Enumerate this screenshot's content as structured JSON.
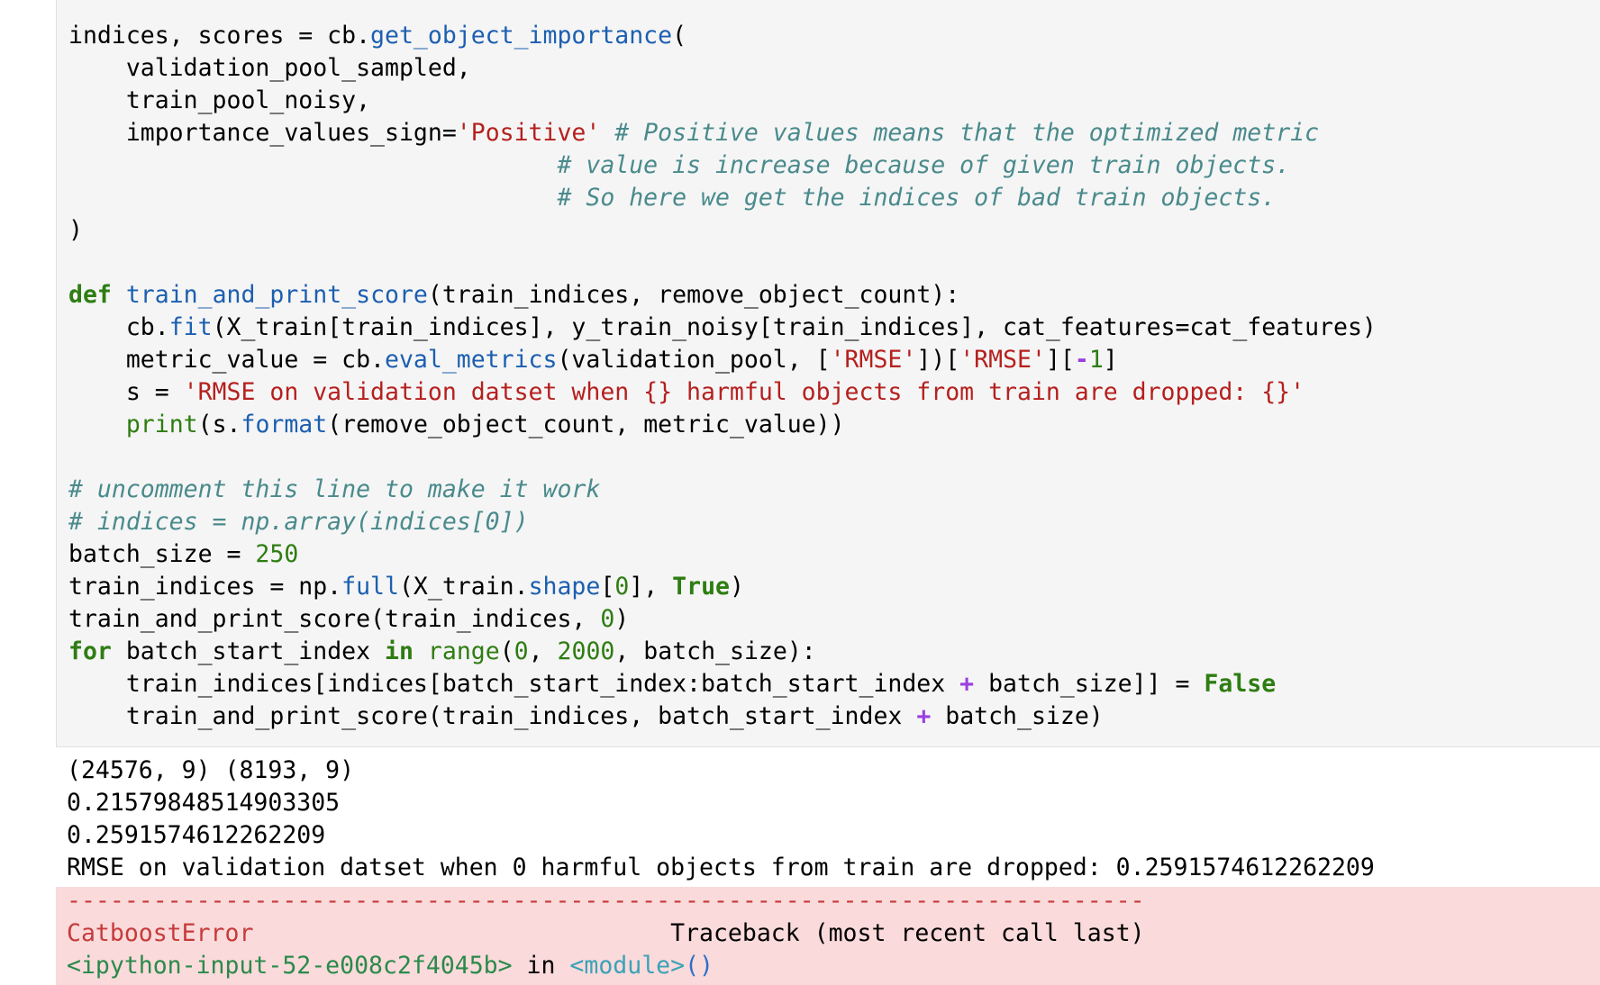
{
  "code": {
    "l1": {
      "a": "indices, scores = cb.",
      "b": "get_object_importance",
      "c": "("
    },
    "l2": "    validation_pool_sampled,",
    "l3": "    train_pool_noisy,",
    "l4": {
      "a": "    importance_values_sign=",
      "b": "'Positive'",
      "c": " ",
      "d": "# Positive values means that the optimized metric"
    },
    "l5": {
      "a": "                                  ",
      "b": "# value is increase because of given train objects."
    },
    "l6": {
      "a": "                                  ",
      "b": "# So here we get the indices of bad train objects."
    },
    "l7": ")",
    "l8": "",
    "l9": {
      "a": "def",
      "b": " ",
      "c": "train_and_print_score",
      "d": "(train_indices, remove_object_count):"
    },
    "l10": {
      "a": "    cb.",
      "b": "fit",
      "c": "(X_train[train_indices], y_train_noisy[train_indices], cat_features=cat_features)"
    },
    "l11": {
      "a": "    metric_value = cb.",
      "b": "eval_metrics",
      "c": "(validation_pool, [",
      "d": "'RMSE'",
      "e": "])[",
      "f": "'RMSE'",
      "g": "][",
      "h": "-",
      "i": "1",
      "j": "]"
    },
    "l12": {
      "a": "    s = ",
      "b": "'RMSE on validation datset when {} harmful objects from train are dropped: {}'"
    },
    "l13": {
      "a": "    ",
      "b": "print",
      "c": "(s.",
      "d": "format",
      "e": "(remove_object_count, metric_value))"
    },
    "l14": "",
    "l15": "# uncomment this line to make it work",
    "l16": "# indices = np.array(indices[0])",
    "l17": {
      "a": "batch_size = ",
      "b": "250"
    },
    "l18": {
      "a": "train_indices = np.",
      "b": "full",
      "c": "(X_train.",
      "d": "shape",
      "e": "[",
      "f": "0",
      "g": "], ",
      "h": "True",
      "i": ")"
    },
    "l19": {
      "a": "train_and_print_score(train_indices, ",
      "b": "0",
      "c": ")"
    },
    "l20": {
      "a": "for",
      "b": " batch_start_index ",
      "c": "in",
      "d": " ",
      "e": "range",
      "f": "(",
      "g": "0",
      "h": ", ",
      "i": "2000",
      "j": ", batch_size):"
    },
    "l21": {
      "a": "    train_indices[indices[batch_start_index:batch_start_index ",
      "b": "+",
      "c": " batch_size]] = ",
      "d": "False"
    },
    "l22": {
      "a": "    train_and_print_score(train_indices, batch_start_index ",
      "b": "+",
      "c": " batch_size)"
    }
  },
  "output": {
    "o1": "(24576, 9) (8193, 9)",
    "o2": "0.21579848514903305",
    "o3": "0.2591574612262209",
    "o4": "RMSE on validation datset when 0 harmful objects from train are dropped: 0.2591574612262209"
  },
  "error": {
    "dashes": "---------------------------------------------------------------------------",
    "type": "CatboostError",
    "spacer": "                             ",
    "traceback": "Traceback (most recent call last)",
    "input_ref": "<ipython-input-52-e008c2f4045b>",
    "in_word": " in ",
    "module": "<module>",
    "parens": "()"
  }
}
